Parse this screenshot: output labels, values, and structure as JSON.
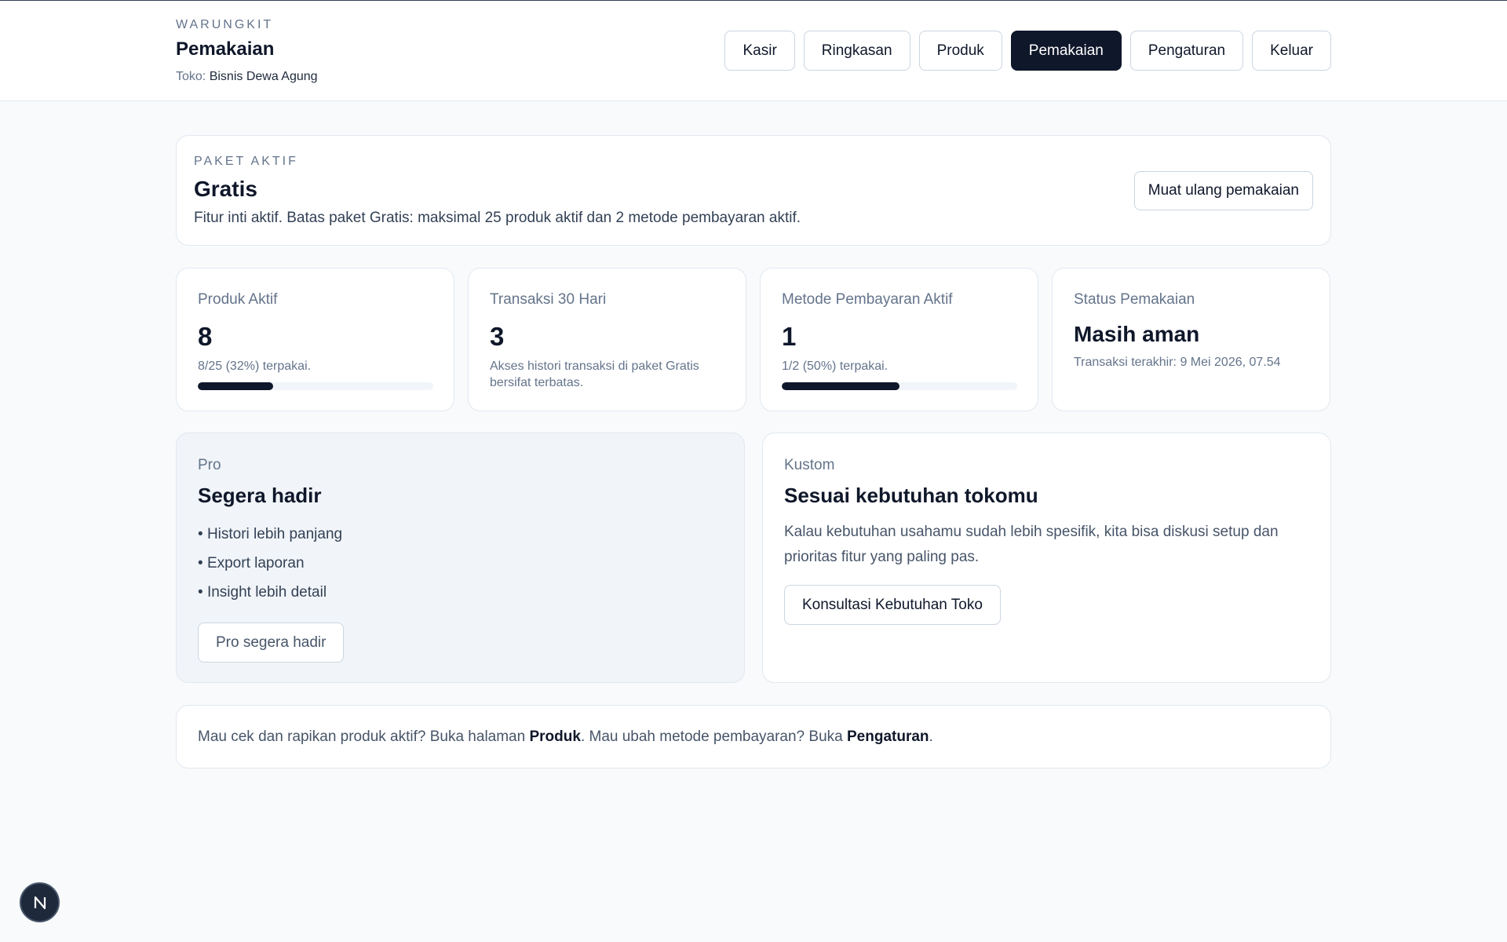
{
  "header": {
    "brand": "WARUNGKIT",
    "title": "Pemakaian",
    "store_label": "Toko:",
    "store_name": "Bisnis Dewa Agung",
    "nav": [
      {
        "label": "Kasir",
        "active": false
      },
      {
        "label": "Ringkasan",
        "active": false
      },
      {
        "label": "Produk",
        "active": false
      },
      {
        "label": "Pemakaian",
        "active": true
      },
      {
        "label": "Pengaturan",
        "active": false
      },
      {
        "label": "Keluar",
        "active": false
      }
    ]
  },
  "plan": {
    "kicker": "PAKET AKTIF",
    "name": "Gratis",
    "description": "Fitur inti aktif. Batas paket Gratis: maksimal 25 produk aktif dan 2 metode pembayaran aktif.",
    "reload_label": "Muat ulang pemakaian"
  },
  "stats": {
    "products": {
      "label": "Produk Aktif",
      "value": "8",
      "note": "8/25 (32%) terpakai.",
      "usage_fraction": 0.32
    },
    "transactions": {
      "label": "Transaksi 30 Hari",
      "value": "3",
      "note": "Akses histori transaksi di paket Gratis bersifat terbatas."
    },
    "payment_methods": {
      "label": "Metode Pembayaran Aktif",
      "value": "1",
      "note": "1/2 (50%) terpakai.",
      "usage_fraction": 0.5
    },
    "status": {
      "label": "Status Pemakaian",
      "value": "Masih aman",
      "note": "Transaksi terakhir: 9 Mei 2026, 07.54"
    }
  },
  "pro": {
    "label": "Pro",
    "title": "Segera hadir",
    "features": [
      "Histori lebih panjang",
      "Export laporan",
      "Insight lebih detail"
    ],
    "button_label": "Pro segera hadir"
  },
  "custom": {
    "label": "Kustom",
    "title": "Sesuai kebutuhan tokomu",
    "description": "Kalau kebutuhan usahamu sudah lebih spesifik, kita bisa diskusi setup dan prioritas fitur yang paling pas.",
    "button_label": "Konsultasi Kebutuhan Toko"
  },
  "footer": {
    "text_1": "Mau cek dan rapikan produk aktif? Buka halaman ",
    "link_products": "Produk",
    "text_2": ". Mau ubah metode pembayaran? Buka ",
    "link_settings": "Pengaturan",
    "text_3": "."
  },
  "colors": {
    "primary": "#0f172a",
    "muted": "#64748b",
    "border": "#e2e8f0",
    "background": "#f8fafc"
  },
  "fab": {
    "icon": "nextjs-logo-icon"
  }
}
